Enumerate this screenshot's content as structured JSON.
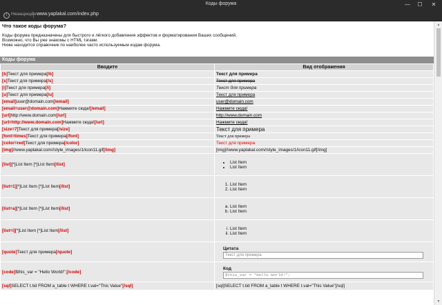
{
  "window": {
    "title": "Коды форума",
    "minimize": "—",
    "maximize": "☐",
    "close": "✕"
  },
  "address": {
    "security": "Незащищён",
    "url": "www.yaplakal.com/index.php"
  },
  "intro": {
    "heading": "Что такое коды форума?",
    "line1": "Коды форума предназначены для быстрого и лёгкого добавления эффектов и форматирования Ваших сообщений.",
    "line2": "Возможно, что Вы уже знакомы с HTML тэгами.",
    "line3": "Ниже находится справочник по наиболее часто используемым кодам форума."
  },
  "section_title": "Коды форума",
  "headers": {
    "input": "Вводите",
    "display": "Вид отображения"
  },
  "rows": {
    "b": {
      "open": "[b]",
      "text": "Текст для примера",
      "close": "[/b]",
      "out": "Текст для примера"
    },
    "s": {
      "open": "[s]",
      "text": "Текст для примера",
      "close": "[/s]",
      "out": "Текст для примера"
    },
    "i": {
      "open": "[i]",
      "text": "Текст для примера",
      "close": "[/i]",
      "out": "Текст для примера"
    },
    "u": {
      "open": "[u]",
      "text": "Текст для примера",
      "close": "[/u]",
      "out": "Текст для примера"
    },
    "email": {
      "open": "[email]",
      "text": "user@domain.com",
      "close": "[/email]",
      "out": "user@domain.com"
    },
    "email2": {
      "open": "[email=user@domain.com]",
      "text": "Нажмите сюда!",
      "close": "[/email]",
      "out": "Нажмите сюда!"
    },
    "url": {
      "open": "[url]",
      "text": "http://www.domain.com",
      "close": "[/url]",
      "out": "http://www.domain.com"
    },
    "url2": {
      "open": "[url=http://www.domain.com]",
      "text": "Нажмите сюда!",
      "close": "[/url]",
      "out": "Нажмите сюда!"
    },
    "size": {
      "open": "[size=7]",
      "text": "Текст для примера",
      "close": "[/size]",
      "out": "Текст для примера"
    },
    "font": {
      "open": "[font=times]",
      "text": "Текст для примера",
      "close": "[/font]",
      "out": "Текст для примера"
    },
    "color": {
      "open": "[color=red]",
      "text": "Текст для примера",
      "close": "[/color]",
      "out": "Текст для примера"
    },
    "img": {
      "open": "[img]",
      "text": "//www.yaplakal.com//style_images/1/icon11.gif",
      "close": "[/img]",
      "out": "[img]//www.yaplakal.com//style_images/1/icon11.gif[/img]"
    },
    "list": {
      "open": "[list]",
      "text": "[*]List Item [*]List Item",
      "close": "[/list]",
      "items": [
        "List Item",
        "List Item"
      ]
    },
    "list1": {
      "open": "[list=1]",
      "text": "[*]List Item [*]List Item",
      "close": "[/list]",
      "items": [
        "List Item",
        "List Item"
      ]
    },
    "lista": {
      "open": "[list=a]",
      "text": "[*]List Item [*]List Item",
      "close": "[/list]",
      "items": [
        "List Item",
        "List Item"
      ]
    },
    "listi": {
      "open": "[list=i]",
      "text": "[*]List Item [*]List Item",
      "close": "[/list]",
      "items": [
        "List Item",
        "List Item"
      ]
    },
    "quote": {
      "open": "[quote]",
      "text": "Текст для примера",
      "close": "[/quote]",
      "label": "Цитата",
      "out": "Текст для примера"
    },
    "code": {
      "open": "[code]",
      "text": "$this_var = \"Hello World!\";",
      "close": "[/code]",
      "label": "Код",
      "out": "$this_var = \"Hello World!\";"
    },
    "sql": {
      "open": "[sql]",
      "text": "SELECT t.tid FROM a_table t WHERE t.val=\"This Value\"",
      "close": "[/sql]",
      "out": "[sql]SELECT t.tid FROM a_table t WHERE t.val=\"This Value\"[/sql]"
    }
  }
}
